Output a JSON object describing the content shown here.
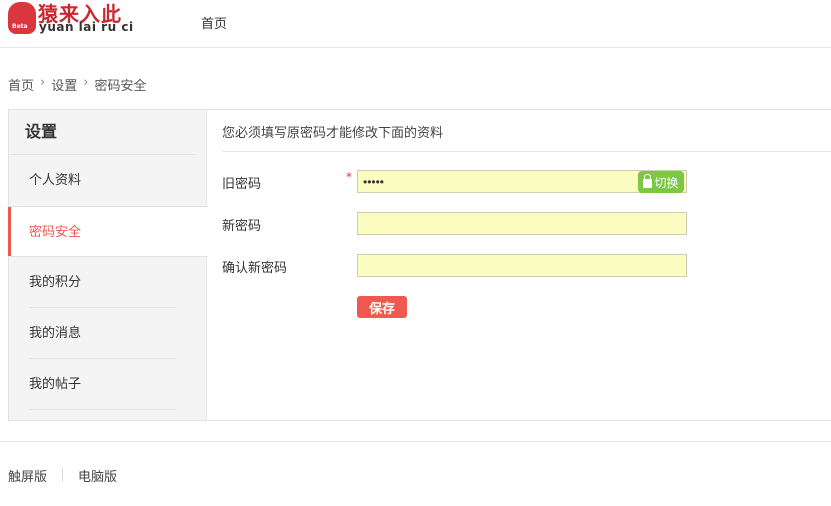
{
  "header": {
    "logo_cn": "猿来入此",
    "logo_en": "yuan lai ru ci",
    "logo_badge": "Beta",
    "nav_home": "首页"
  },
  "breadcrumb": [
    "首页",
    "设置",
    "密码安全"
  ],
  "sidebar": {
    "title": "设置",
    "items": [
      {
        "label": "个人资料"
      },
      {
        "label": "密码安全",
        "active": true
      },
      {
        "label": "我的积分"
      },
      {
        "label": "我的消息"
      },
      {
        "label": "我的帖子"
      }
    ]
  },
  "form": {
    "notice": "您必须填写原密码才能修改下面的资料",
    "old_label": "旧密码",
    "old_value": "*****",
    "required_mark": "*",
    "toggle_label": "切换",
    "new_label": "新密码",
    "confirm_label": "确认新密码",
    "save_label": "保存"
  },
  "footer": {
    "touch": "触屏版",
    "pc": "电脑版"
  },
  "colors": {
    "accent": "#ef5a50",
    "toggle": "#7cc843",
    "input_bg": "#fafcc0"
  }
}
